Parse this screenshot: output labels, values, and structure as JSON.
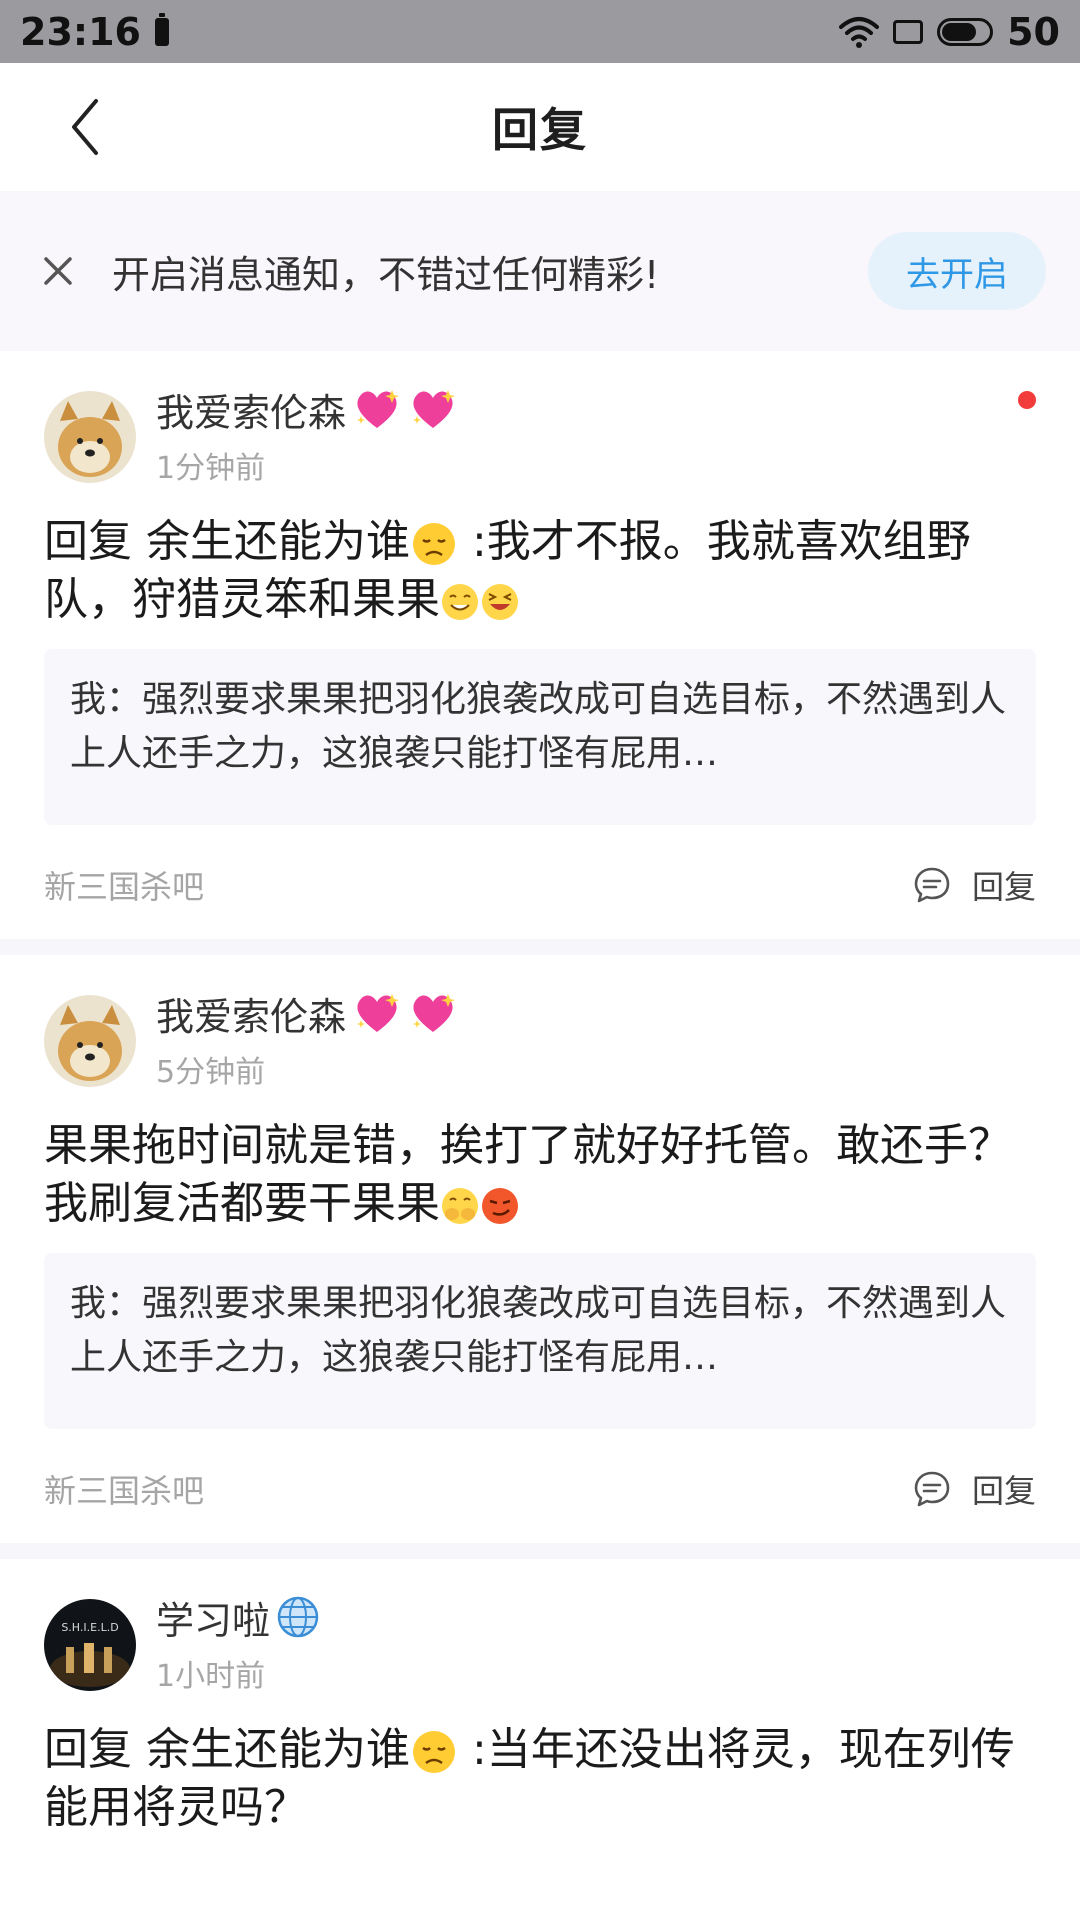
{
  "status_bar": {
    "time": "23:16",
    "battery_level": "50",
    "icons": [
      "battery-small-icon",
      "wifi-icon",
      "screen-icon",
      "battery-icon"
    ]
  },
  "navbar": {
    "title": "回复",
    "back_icon": "chevron-left-icon"
  },
  "notice": {
    "text": "开启消息通知，不错过任何精彩!",
    "button_label": "去开启",
    "close_icon": "close-icon"
  },
  "cards": [
    {
      "username": "我爱索伦森",
      "timestamp": "1分钟前",
      "unread": true,
      "reply_prefix": "回复 余生还能为谁",
      "reply_body": " :我才不报。我就喜欢组野队，狩猎灵笨和果果",
      "quote": "我：强烈要求果果把羽化狼袭改成可自选目标，不然遇到人上人还手之力，这狼袭只能打怪有屁用…",
      "forum": "新三国杀吧",
      "reply_label": "回复"
    },
    {
      "username": "我爱索伦森",
      "timestamp": "5分钟前",
      "unread": false,
      "reply_prefix": "",
      "reply_body": "果果拖时间就是错，挨打了就好好托管。敢还手？我刷复活都要干果果",
      "quote": "我：强烈要求果果把羽化狼袭改成可自选目标，不然遇到人上人还手之力，这狼袭只能打怪有屁用…",
      "forum": "新三国杀吧",
      "reply_label": "回复"
    },
    {
      "username": "学习啦",
      "timestamp": "1小时前",
      "unread": false,
      "reply_prefix": "回复 余生还能为谁",
      "reply_body": " :当年还没出将灵，现在列传能用将灵吗？",
      "quote": "",
      "forum": "",
      "reply_label": ""
    }
  ],
  "colors": {
    "accent": "#2f98e6",
    "unread_dot": "#f23c3c",
    "status_bar_bg": "#9b9b9f"
  }
}
